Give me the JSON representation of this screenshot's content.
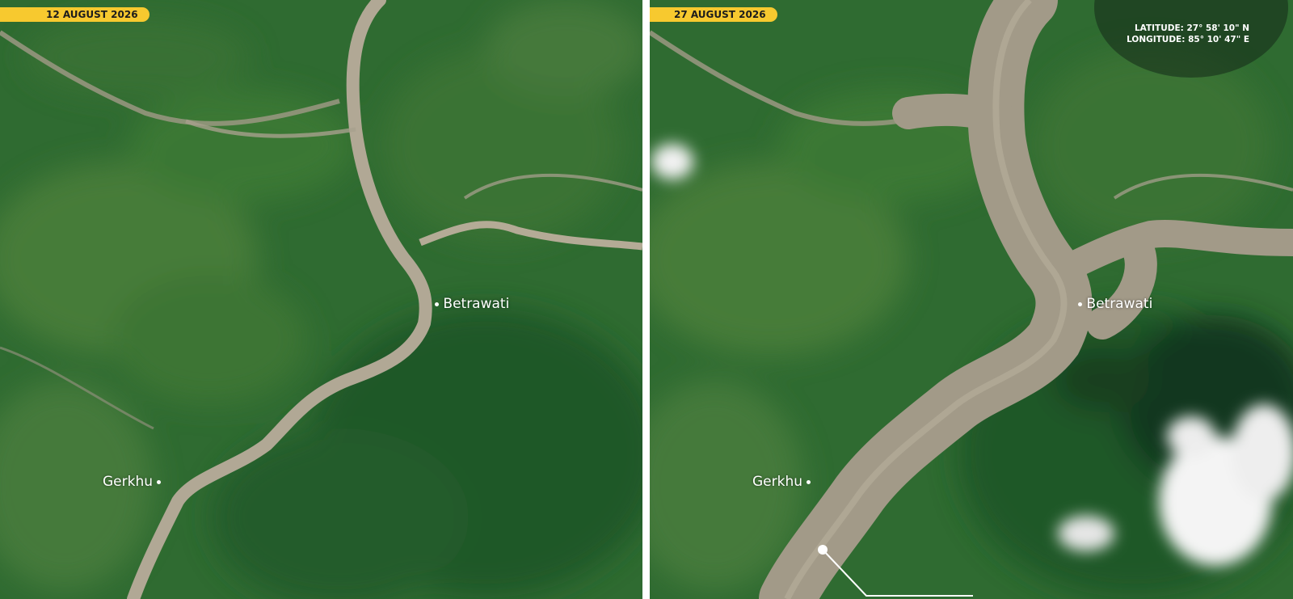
{
  "panels": {
    "before": {
      "date": "12 AUGUST 2026"
    },
    "after": {
      "date": "27 AUGUST 2026"
    }
  },
  "places": {
    "betrawati": "Betrawati",
    "gerkhu": "Gerkhu"
  },
  "coordinates": {
    "latitude": "LATITUDE: 27° 58' 10\" N",
    "longitude": "LONGITUDE: 85° 10' 47\" E"
  },
  "colors": {
    "badge": "#f7c92f",
    "vegetation": "#2e6a30",
    "river_sediment": "#a29a88",
    "cloud": "#f2f2f2"
  }
}
